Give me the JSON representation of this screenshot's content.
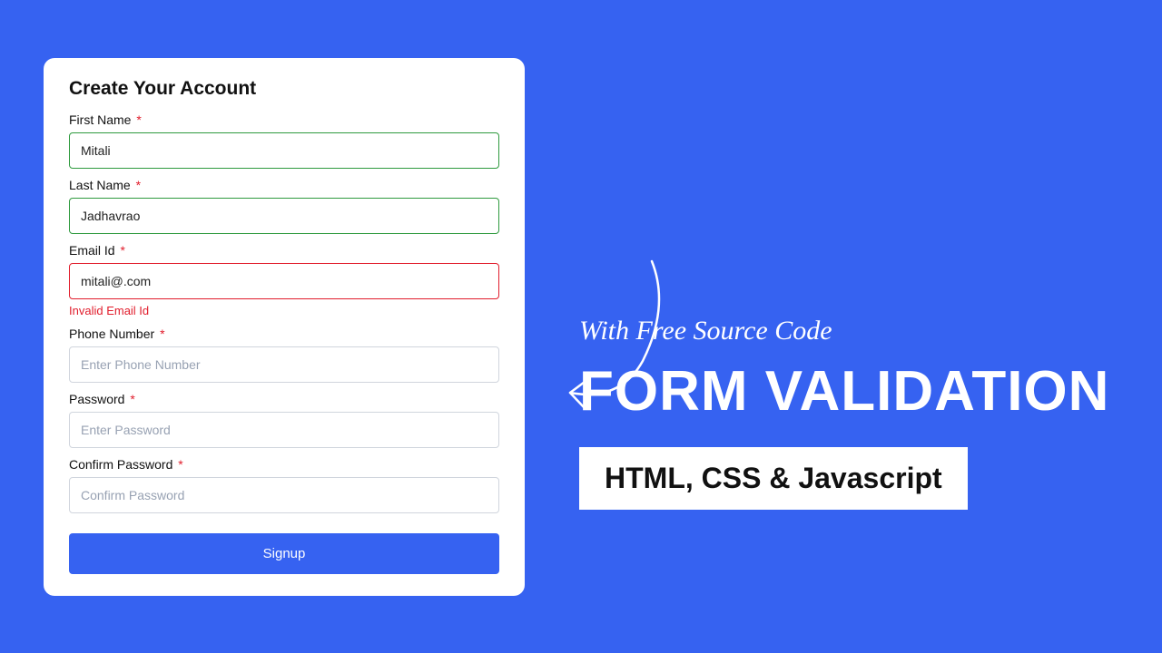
{
  "form": {
    "title": "Create Your Account",
    "firstName": {
      "label": "First Name",
      "value": "Mitali"
    },
    "lastName": {
      "label": "Last Name",
      "value": "Jadhavrao"
    },
    "email": {
      "label": "Email Id",
      "value": "mitali@.com",
      "error": "Invalid Email Id"
    },
    "phone": {
      "label": "Phone Number",
      "placeholder": "Enter Phone Number"
    },
    "password": {
      "label": "Password",
      "placeholder": "Enter Password"
    },
    "confirmPassword": {
      "label": "Confirm Password",
      "placeholder": "Confirm Password"
    },
    "submit": "Signup",
    "requiredMark": "*"
  },
  "promo": {
    "subtitle": "With Free Source Code",
    "title": "FORM VALIDATION",
    "badge": "HTML, CSS & Javascript"
  }
}
